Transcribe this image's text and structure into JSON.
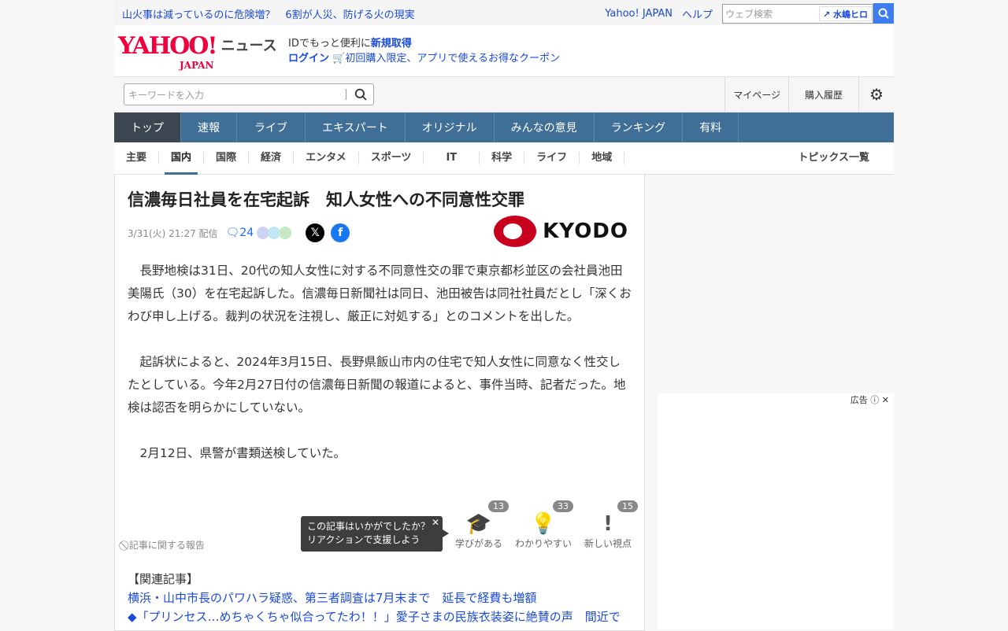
{
  "top": {
    "headline": "山火事は減っているのに危険増？　6割が人災、防げる火の現実",
    "yahoo_japan": "Yahoo! JAPAN",
    "help": "ヘルプ",
    "web_search_placeholder": "ウェブ検索",
    "trend_tag": "水嶋ヒロ"
  },
  "header": {
    "logo": "YAHOO! JAPAN",
    "logo_news": "ニュース",
    "promo_line1": "IDでもっと便利に",
    "promo_signup": "新規取得",
    "login": "ログイン",
    "coupon": "初回購入限定、アプリで使えるお得なクーポン"
  },
  "search": {
    "placeholder": "キーワードを入力",
    "mypage": "マイページ",
    "history": "購入履歴"
  },
  "nav": [
    "トップ",
    "速報",
    "ライブ",
    "エキスパート",
    "オリジナル",
    "みんなの意見",
    "ランキング",
    "有料"
  ],
  "subnav": [
    "主要",
    "国内",
    "国際",
    "経済",
    "エンタメ",
    "スポーツ",
    "IT",
    "科学",
    "ライフ",
    "地域"
  ],
  "topics": "トピックス一覧",
  "article": {
    "title": "信濃毎日社員を在宅起訴　知人女性への不同意性交罪",
    "date": "3/31(火) 21:27 配信",
    "comments": "24",
    "source": "KYODO",
    "paragraphs": [
      "　長野地検は31日、20代の知人女性に対する不同意性交の罪で東京都杉並区の会社員池田美陽氏（30）を在宅起訴した。信濃毎日新聞社は同日、池田被告は同社社員だとし「深くおわび申し上げる。裁判の状況を注視し、厳正に対処する」とのコメントを出した。",
      "　起訴状によると、2024年3月15日、長野県飯山市内の住宅で知人女性に同意なく性交したとしている。今年2月27日付の信濃毎日新聞の報道によると、事件当時、記者だった。地検は認否を明らかにしていない。",
      "　2月12日、県警が書類送検していた。"
    ],
    "report": "記事に関する報告",
    "tooltip_line1": "この記事はいかがでしたか？",
    "tooltip_line2": "リアクションで支援しよう",
    "reactions": [
      {
        "label": "学びがある",
        "count": "13"
      },
      {
        "label": "わかりやすい",
        "count": "33"
      },
      {
        "label": "新しい視点",
        "count": "15"
      }
    ],
    "related_heading": "【関連記事】",
    "related": [
      "横浜・山中市長のパワハラ疑惑、第三者調査は7月末まで　延長で経費も増額",
      "◆「プリンセス…めちゃくちゃ似合ってたわ！！」愛子さまの民族衣装姿に絶賛の声　間近で"
    ]
  },
  "ad": {
    "label": "広告"
  }
}
